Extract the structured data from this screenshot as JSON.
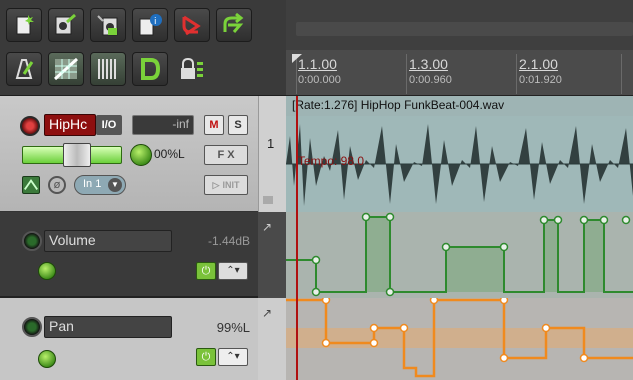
{
  "toolbar": {
    "buttons": [
      {
        "name": "new-project-icon"
      },
      {
        "name": "open-project-icon"
      },
      {
        "name": "save-project-icon"
      },
      {
        "name": "project-info-icon"
      },
      {
        "name": "undo-icon"
      },
      {
        "name": "redo-icon"
      },
      {
        "name": "metronome-icon"
      },
      {
        "name": "snap-grid-icon"
      },
      {
        "name": "grid-lines-icon"
      },
      {
        "name": "ripple-edit-icon"
      },
      {
        "name": "lock-icon"
      }
    ]
  },
  "ruler": {
    "marks": [
      {
        "bar": "1.1.00",
        "time": "0:00.000"
      },
      {
        "bar": "1.3.00",
        "time": "0:00.960"
      },
      {
        "bar": "2.1.00",
        "time": "0:01.920"
      }
    ]
  },
  "track": {
    "name": "HipHc",
    "io_label": "I/O",
    "volume": "-inf",
    "mute_label": "M",
    "solo_label": "S",
    "pan": "00%L",
    "fx_label": "F X",
    "input": "In 1",
    "number": "1",
    "phase_label": "ø",
    "mode_label": "INIT"
  },
  "envelopes": [
    {
      "name": "Volume",
      "value": "-1.44dB"
    },
    {
      "name": "Pan",
      "value": "99%L"
    }
  ],
  "item": {
    "title": "[Rate:1.276] HipHop FunkBeat-004.wav",
    "tempo_label": "Tempo: 98.0"
  },
  "colors": {
    "volume_env": "#2e8a2e",
    "pan_env": "#f08a1e",
    "playhead": "#b01010",
    "knob": "#5cb82a"
  }
}
